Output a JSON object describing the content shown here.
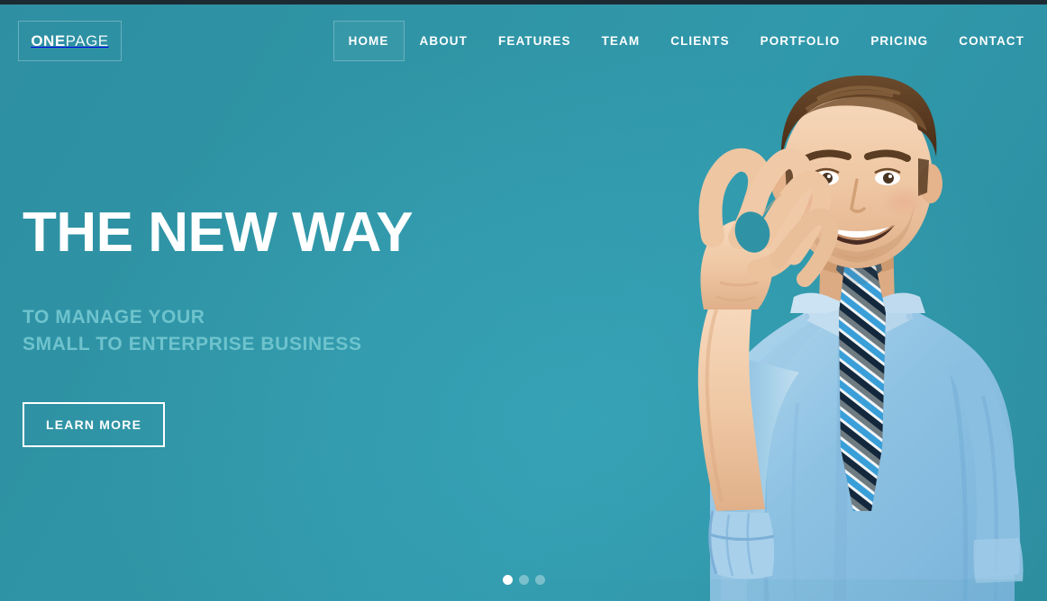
{
  "site": {
    "logo": {
      "bold_part": "ONE",
      "light_part": "PAGE"
    },
    "accent_color": "#2e92a4",
    "subtitle_color": "#6ec3cd",
    "topbar_color": "#1c2b33"
  },
  "nav": {
    "items": [
      {
        "label": "HOME",
        "active": true
      },
      {
        "label": "ABOUT",
        "active": false
      },
      {
        "label": "FEATURES",
        "active": false
      },
      {
        "label": "TEAM",
        "active": false
      },
      {
        "label": "CLIENTS",
        "active": false
      },
      {
        "label": "PORTFOLIO",
        "active": false
      },
      {
        "label": "PRICING",
        "active": false
      },
      {
        "label": "CONTACT",
        "active": false
      }
    ]
  },
  "hero": {
    "headline": "THE NEW WAY",
    "subhead_line1": "TO MANAGE YOUR",
    "subhead_line2": "SMALL TO ENTERPRISE BUSINESS",
    "cta_label": "LEARN MORE",
    "image_alt": "smiling businessman in light blue shirt and striped tie making an OK hand gesture"
  },
  "carousel": {
    "slide_count": 3,
    "active_index": 0
  }
}
